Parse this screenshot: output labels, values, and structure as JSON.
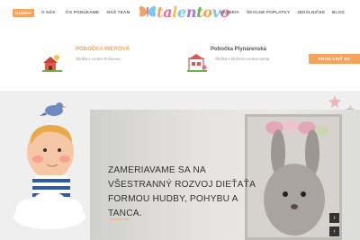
{
  "nav": {
    "items": [
      {
        "label": "DOMOV",
        "active": true
      },
      {
        "label": "O NÁS"
      },
      {
        "label": "ČO PONÚKAME"
      },
      {
        "label": "NÁŠ TEAM"
      },
      {
        "label": "GALÉRIA"
      },
      {
        "label": "ŠKOLNÉ POPLATKY"
      },
      {
        "label": "JEDÁLNIČEK"
      },
      {
        "label": "BLOG"
      }
    ],
    "logo_text": "talentovo"
  },
  "branches": [
    {
      "title": "POBOČKA MIEROVÁ",
      "subtitle": "Škôlka v centre Ružinova",
      "title_color": "#f7a35c",
      "icon": "house-sun-icon"
    },
    {
      "title": "Pobočka Plynárenská",
      "subtitle": "Škôlka v blízkosti centra mesta",
      "title_color": "#555555",
      "icon": "building-flower-icon"
    }
  ],
  "cta": {
    "label": "PRIHLÁSIŤ SA"
  },
  "hero": {
    "headline": "ZAMERIAVAME SA NA VŠESTRANNÝ ROZVOJ DIEŤAŤA FORMOU HUDBY, POHYBU A TANCA.",
    "link_text": "prečítať viac",
    "prev_icon": "chevron-right-icon",
    "next_icon": "chevron-left-icon"
  },
  "colors": {
    "accent": "#f7a35c",
    "text": "#333333",
    "muted": "#999999"
  }
}
